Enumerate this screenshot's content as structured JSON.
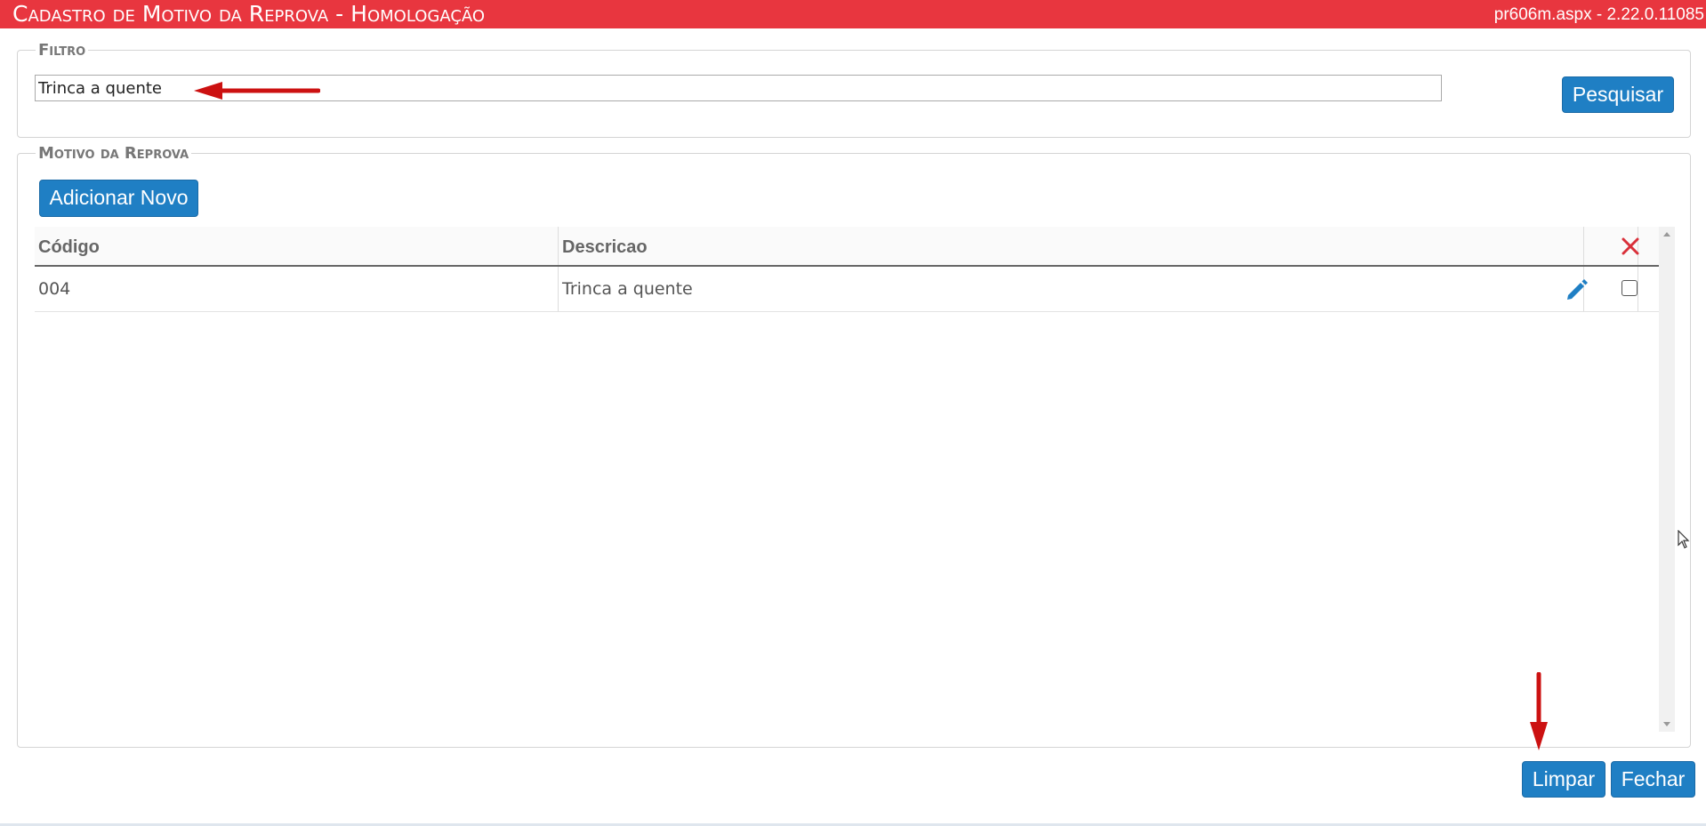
{
  "header": {
    "title": "Cadastro de Motivo da Reprova  - Homologação",
    "version": "pr606m.aspx - 2.22.0.11085"
  },
  "filter": {
    "legend": "Filtro",
    "value": "Trinca a quente",
    "search_label": "Pesquisar"
  },
  "motivo": {
    "legend": "Motivo da Reprova",
    "add_label": "Adicionar Novo",
    "columns": [
      "Código",
      "Descricao"
    ],
    "rows": [
      {
        "codigo": "004",
        "descricao": "Trinca a quente",
        "selected": false
      }
    ]
  },
  "footer": {
    "clear_label": "Limpar",
    "close_label": "Fechar"
  },
  "colors": {
    "topbar": "#e8363f",
    "button": "#1f7fc4",
    "annotation": "#cc1111"
  }
}
